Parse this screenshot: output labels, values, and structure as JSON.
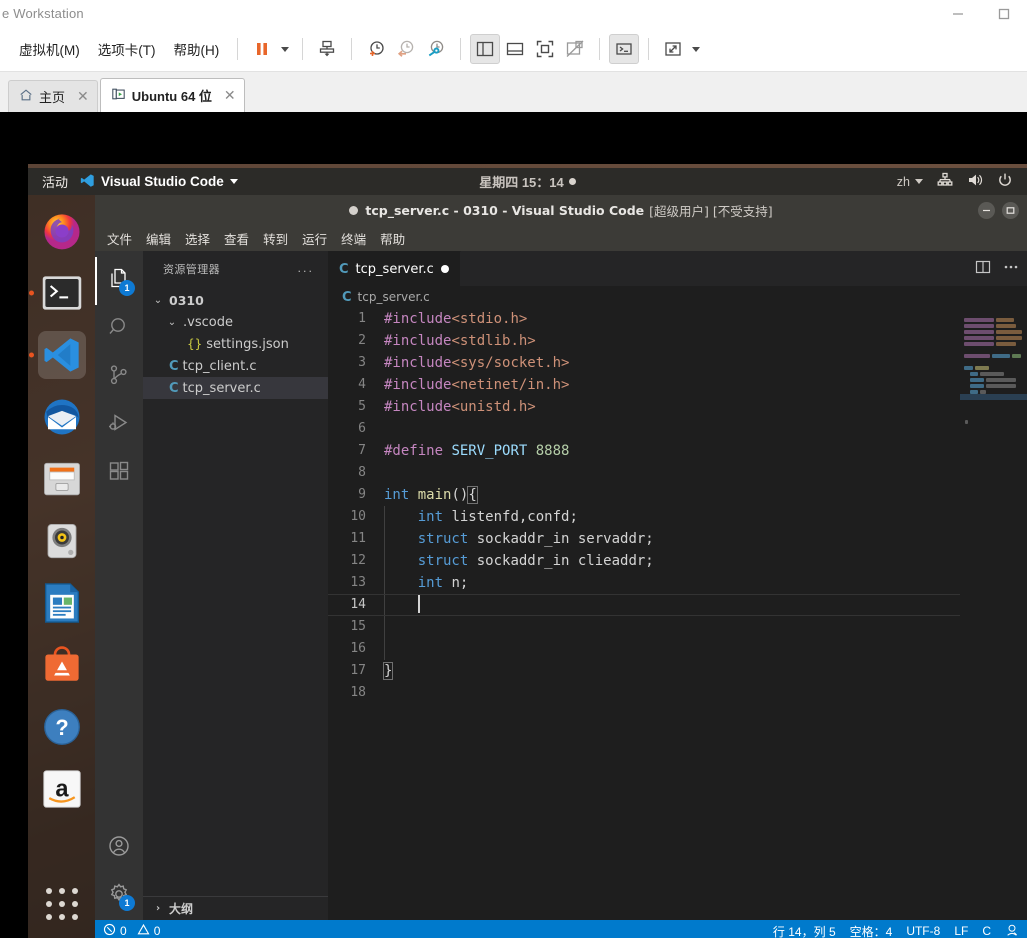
{
  "vmware": {
    "window_title": "e Workstation",
    "window_buttons": [
      "minimize",
      "maximize"
    ],
    "menus": [
      {
        "label": "虚拟机(M)",
        "name": "menu-virtual-machine"
      },
      {
        "label": "选项卡(T)",
        "name": "menu-tabs"
      },
      {
        "label": "帮助(H)",
        "name": "menu-help"
      }
    ],
    "toolbar": [
      {
        "name": "suspend-button",
        "icon": "pause-icon"
      },
      {
        "name": "power-dropdown",
        "icon": "chevron-down-icon"
      },
      {
        "name": "snapshot-manager-button",
        "icon": "snapshot-icon"
      },
      {
        "name": "take-snapshot-button",
        "icon": "clock-plus-icon"
      },
      {
        "name": "revert-snapshot-button",
        "icon": "clock-back-icon"
      },
      {
        "name": "manage-snapshots-button",
        "icon": "clock-wrench-icon"
      },
      {
        "name": "show-sidebar-button",
        "icon": "sidebar-panel-icon"
      },
      {
        "name": "show-console-view-button",
        "icon": "split-bottom-icon"
      },
      {
        "name": "fullscreen-button",
        "icon": "fullscreen-icon"
      },
      {
        "name": "unity-mode-button",
        "icon": "unity-icon"
      },
      {
        "name": "console-button",
        "icon": "terminal-icon"
      },
      {
        "name": "stretch-button",
        "icon": "expand-diagonal-icon"
      },
      {
        "name": "stretch-dropdown",
        "icon": "chevron-down-icon"
      }
    ],
    "tabs": [
      {
        "label": "主页",
        "icon": "home-icon",
        "selected": false,
        "closable": true
      },
      {
        "label": "Ubuntu 64 位",
        "icon": "vm-icon",
        "selected": true,
        "closable": true
      }
    ]
  },
  "ubuntu": {
    "panel": {
      "activities": "活动",
      "app_name": "Visual Studio Code",
      "clock": "星期四 15：14",
      "language": "zh",
      "indicators": [
        "network-icon",
        "volume-icon",
        "power-icon"
      ]
    },
    "dock": [
      {
        "name": "dock-item-firefox",
        "label": "Firefox",
        "running": false,
        "focused": false
      },
      {
        "name": "dock-item-terminal",
        "label": "终端",
        "running": true,
        "focused": false
      },
      {
        "name": "dock-item-vscode",
        "label": "Visual Studio Code",
        "running": true,
        "focused": true
      },
      {
        "name": "dock-item-thunderbird",
        "label": "Thunderbird",
        "running": false,
        "focused": false
      },
      {
        "name": "dock-item-files",
        "label": "文件",
        "running": false,
        "focused": false
      },
      {
        "name": "dock-item-rhythmbox",
        "label": "Rhythmbox",
        "running": false,
        "focused": false
      },
      {
        "name": "dock-item-libreoffice-writer",
        "label": "LibreOffice Writer",
        "running": false,
        "focused": false
      },
      {
        "name": "dock-item-ubuntu-software",
        "label": "Ubuntu Software",
        "running": false,
        "focused": false
      },
      {
        "name": "dock-item-help",
        "label": "帮助",
        "running": false,
        "focused": false
      },
      {
        "name": "dock-item-amazon",
        "label": "Amazon",
        "running": false,
        "focused": false
      }
    ],
    "show_applications_label": "显示应用程序"
  },
  "vscode": {
    "title": "tcp_server.c - 0310 - Visual Studio Code",
    "title_prefix_dirty": true,
    "title_suffix": "[超级用户] [不受支持]",
    "menus": [
      "文件",
      "编辑",
      "选择",
      "查看",
      "转到",
      "运行",
      "终端",
      "帮助"
    ],
    "activitybar": [
      {
        "name": "activity-explorer",
        "icon": "files-icon",
        "badge": "1",
        "active": true
      },
      {
        "name": "activity-search",
        "icon": "search-icon",
        "badge": "",
        "active": false
      },
      {
        "name": "activity-source-control",
        "icon": "source-control-icon",
        "badge": "",
        "active": false
      },
      {
        "name": "activity-run-debug",
        "icon": "run-debug-icon",
        "badge": "",
        "active": false
      },
      {
        "name": "activity-extensions",
        "icon": "extensions-icon",
        "badge": "",
        "active": false
      }
    ],
    "activitybar_bottom": [
      {
        "name": "activity-accounts",
        "icon": "account-icon",
        "badge": ""
      },
      {
        "name": "activity-manage",
        "icon": "gear-icon",
        "badge": "1"
      }
    ],
    "sidebar": {
      "title": "资源管理器",
      "more_actions": "...",
      "tree": [
        {
          "label": "0310",
          "kind": "folder",
          "expanded": true,
          "depth": 0,
          "selected": false
        },
        {
          "label": ".vscode",
          "kind": "folder",
          "expanded": true,
          "depth": 1,
          "selected": false
        },
        {
          "label": "settings.json",
          "kind": "json",
          "expanded": null,
          "depth": 2,
          "selected": false
        },
        {
          "label": "tcp_client.c",
          "kind": "c",
          "expanded": null,
          "depth": 1,
          "selected": false
        },
        {
          "label": "tcp_server.c",
          "kind": "c",
          "expanded": null,
          "depth": 1,
          "selected": true
        }
      ],
      "outline_label": "大纲"
    },
    "editor": {
      "tabs": [
        {
          "label": "tcp_server.c",
          "kind": "c",
          "dirty": true,
          "active": true
        }
      ],
      "breadcrumb": "tcp_server.c",
      "actions": [
        "split-editor-icon",
        "more-actions-icon"
      ],
      "lines": [
        {
          "n": "1",
          "segments": [
            {
              "t": "#include",
              "c": "tok-dir"
            },
            {
              "t": "<stdio.h>",
              "c": "tok-inc"
            }
          ]
        },
        {
          "n": "2",
          "segments": [
            {
              "t": "#include",
              "c": "tok-dir"
            },
            {
              "t": "<stdlib.h>",
              "c": "tok-inc"
            }
          ]
        },
        {
          "n": "3",
          "segments": [
            {
              "t": "#include",
              "c": "tok-dir"
            },
            {
              "t": "<sys/socket.h>",
              "c": "tok-inc"
            }
          ]
        },
        {
          "n": "4",
          "segments": [
            {
              "t": "#include",
              "c": "tok-dir"
            },
            {
              "t": "<netinet/in.h>",
              "c": "tok-inc"
            }
          ]
        },
        {
          "n": "5",
          "segments": [
            {
              "t": "#include",
              "c": "tok-dir"
            },
            {
              "t": "<unistd.h>",
              "c": "tok-inc"
            }
          ]
        },
        {
          "n": "6",
          "segments": []
        },
        {
          "n": "7",
          "segments": [
            {
              "t": "#define ",
              "c": "tok-dir"
            },
            {
              "t": "SERV_PORT",
              "c": "tok-id"
            },
            {
              "t": " ",
              "c": "tok-plain"
            },
            {
              "t": "8888",
              "c": "tok-num"
            }
          ]
        },
        {
          "n": "8",
          "segments": []
        },
        {
          "n": "9",
          "segments": [
            {
              "t": "int",
              "c": "tok-kw"
            },
            {
              "t": " ",
              "c": "tok-plain"
            },
            {
              "t": "main",
              "c": "tok-fn"
            },
            {
              "t": "()",
              "c": "tok-plain"
            },
            {
              "t": "{",
              "c": "tok-plain brkt"
            }
          ]
        },
        {
          "n": "10",
          "segments": [
            {
              "t": "    ",
              "c": "tok-plain"
            },
            {
              "t": "int",
              "c": "tok-kw"
            },
            {
              "t": " listenfd,confd;",
              "c": "tok-plain"
            }
          ]
        },
        {
          "n": "11",
          "segments": [
            {
              "t": "    ",
              "c": "tok-plain"
            },
            {
              "t": "struct",
              "c": "tok-kw"
            },
            {
              "t": " sockaddr_in servaddr;",
              "c": "tok-plain"
            }
          ]
        },
        {
          "n": "12",
          "segments": [
            {
              "t": "    ",
              "c": "tok-plain"
            },
            {
              "t": "struct",
              "c": "tok-kw"
            },
            {
              "t": " sockaddr_in clieaddr;",
              "c": "tok-plain"
            }
          ]
        },
        {
          "n": "13",
          "segments": [
            {
              "t": "    ",
              "c": "tok-plain"
            },
            {
              "t": "int",
              "c": "tok-kw"
            },
            {
              "t": " n;",
              "c": "tok-plain"
            }
          ]
        },
        {
          "n": "14",
          "segments": [
            {
              "t": "    ",
              "c": "tok-plain"
            }
          ],
          "active": true,
          "caret": true
        },
        {
          "n": "15",
          "segments": []
        },
        {
          "n": "16",
          "segments": []
        },
        {
          "n": "17",
          "segments": [
            {
              "t": "}",
              "c": "tok-plain brkt"
            }
          ]
        },
        {
          "n": "18",
          "segments": []
        }
      ]
    },
    "statusbar": {
      "errors": "0",
      "warnings": "0",
      "cursor_position": "行 14，列 5",
      "indentation": "空格：4",
      "encoding": "UTF-8",
      "eol": "LF",
      "language": "C",
      "feedback_icon": "smiley-feedback-icon"
    }
  },
  "colors": {
    "accent_blue": "#007acc",
    "vscode_bg": "#1e1e1e",
    "sidebar_bg": "#252526",
    "activitybar_bg": "#333333",
    "ubuntu_panel": "#2c2b28",
    "ubuntu_orange": "#e95420",
    "badge_blue": "#0e7ad4"
  }
}
